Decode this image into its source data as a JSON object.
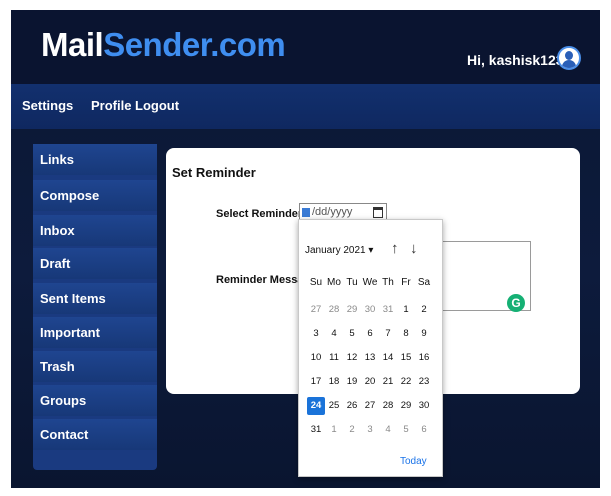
{
  "brand": {
    "part1": "Mail",
    "part2": "Sender.com"
  },
  "user": {
    "greeting": "Hi, kashisk123"
  },
  "topnav": [
    {
      "label": "Settings"
    },
    {
      "label": "Profile"
    },
    {
      "label": "Logout"
    }
  ],
  "sidebar": [
    {
      "label": "Links"
    },
    {
      "label": "Compose"
    },
    {
      "label": "Inbox"
    },
    {
      "label": "Draft"
    },
    {
      "label": "Sent Items"
    },
    {
      "label": "Important"
    },
    {
      "label": "Trash"
    },
    {
      "label": "Groups"
    },
    {
      "label": "Contact"
    }
  ],
  "form": {
    "title": "Set Reminder",
    "date_label": "Select Reminder Date",
    "date_placeholder": "/dd/yyyy",
    "message_label": "Reminder Message"
  },
  "datepicker": {
    "month_label": "January 2021 ▾",
    "prev": "↑",
    "next": "↓",
    "weekdays": [
      "Su",
      "Mo",
      "Tu",
      "We",
      "Th",
      "Fr",
      "Sa"
    ],
    "selected_day": "24",
    "today_label": "Today",
    "weeks": [
      [
        [
          "27",
          true
        ],
        [
          "28",
          true
        ],
        [
          "29",
          true
        ],
        [
          "30",
          true
        ],
        [
          "31",
          true
        ],
        [
          "1",
          false
        ],
        [
          "2",
          false
        ]
      ],
      [
        [
          "3",
          false
        ],
        [
          "4",
          false
        ],
        [
          "5",
          false
        ],
        [
          "6",
          false
        ],
        [
          "7",
          false
        ],
        [
          "8",
          false
        ],
        [
          "9",
          false
        ]
      ],
      [
        [
          "10",
          false
        ],
        [
          "11",
          false
        ],
        [
          "12",
          false
        ],
        [
          "13",
          false
        ],
        [
          "14",
          false
        ],
        [
          "15",
          false
        ],
        [
          "16",
          false
        ]
      ],
      [
        [
          "17",
          false
        ],
        [
          "18",
          false
        ],
        [
          "19",
          false
        ],
        [
          "20",
          false
        ],
        [
          "21",
          false
        ],
        [
          "22",
          false
        ],
        [
          "23",
          false
        ]
      ],
      [
        [
          "24",
          false
        ],
        [
          "25",
          false
        ],
        [
          "26",
          false
        ],
        [
          "27",
          false
        ],
        [
          "28",
          false
        ],
        [
          "29",
          false
        ],
        [
          "30",
          false
        ]
      ],
      [
        [
          "31",
          false
        ],
        [
          "1",
          true
        ],
        [
          "2",
          true
        ],
        [
          "3",
          true
        ],
        [
          "4",
          true
        ],
        [
          "5",
          true
        ],
        [
          "6",
          true
        ]
      ]
    ]
  },
  "colors": {
    "background": "#0d1b3c",
    "nav": "#12306e",
    "sidebar_item": "#1f4590",
    "accent": "#3f8ef0",
    "selected_day": "#1a73d9",
    "grammarly": "#15b074"
  },
  "icons": {
    "avatar": "user-avatar-icon",
    "calendar": "calendar-icon",
    "grammar": "grammarly-icon"
  }
}
